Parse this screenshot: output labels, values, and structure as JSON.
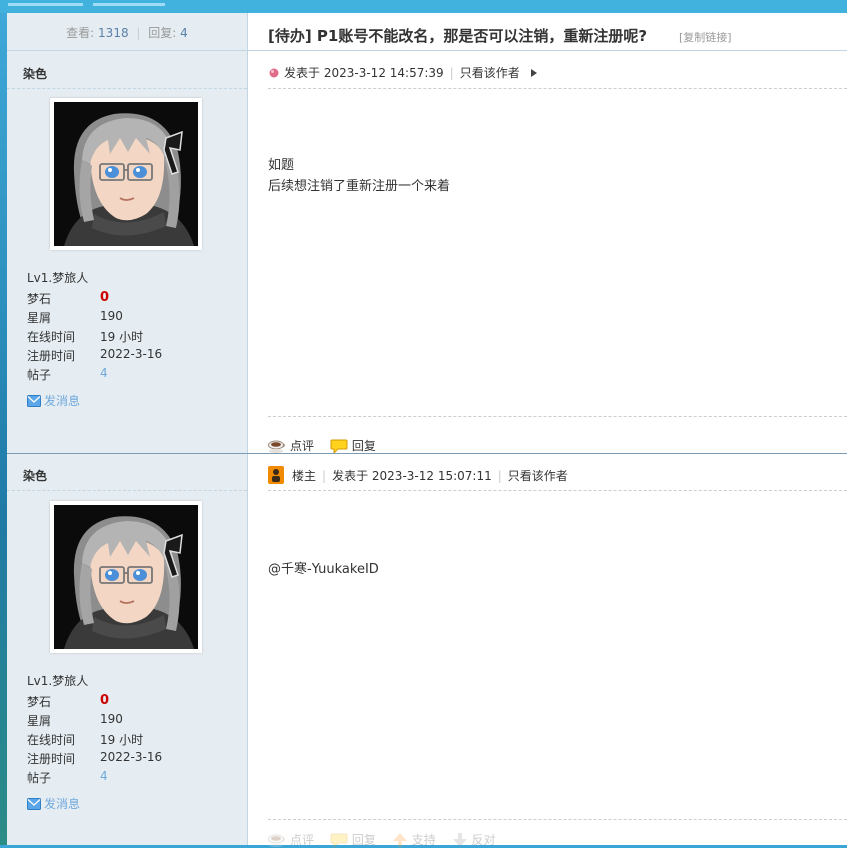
{
  "thread": {
    "views_label": "查看:",
    "views": "1318",
    "replies_label": "回复:",
    "replies": "4",
    "title": "[待办] P1账号不能改名，那是否可以注销，重新注册呢?",
    "copy_link": "[复制链接]"
  },
  "posts": [
    {
      "author": "染色",
      "level": "Lv1.梦旅人",
      "stats": [
        {
          "label": "梦石",
          "value": "0"
        },
        {
          "label": "星屑",
          "value": "190"
        },
        {
          "label": "在线时间",
          "value": "19 小时"
        },
        {
          "label": "注册时间",
          "value": "2022-3-16"
        },
        {
          "label": "帖子",
          "value": "4"
        }
      ],
      "send_message": "发消息",
      "posted_label": "发表于",
      "posted_at": "2023-3-12 14:57:39",
      "only_author": "只看该作者",
      "content_lines": [
        "如题",
        "后续想注销了重新注册一个来着"
      ],
      "actions": {
        "comment": "点评",
        "reply": "回复"
      }
    },
    {
      "author": "染色",
      "level": "Lv1.梦旅人",
      "stats": [
        {
          "label": "梦石",
          "value": "0"
        },
        {
          "label": "星屑",
          "value": "190"
        },
        {
          "label": "在线时间",
          "value": "19 小时"
        },
        {
          "label": "注册时间",
          "value": "2022-3-16"
        },
        {
          "label": "帖子",
          "value": "4"
        }
      ],
      "send_message": "发消息",
      "owner_badge": "楼主",
      "posted_label": "发表于",
      "posted_at": "2023-3-12 15:07:11",
      "only_author": "只看该作者",
      "content_lines": [
        "@千寒-YuukakeID"
      ],
      "actions": {
        "comment": "点评",
        "reply": "回复",
        "support": "支持",
        "oppose": "反对"
      }
    }
  ]
}
